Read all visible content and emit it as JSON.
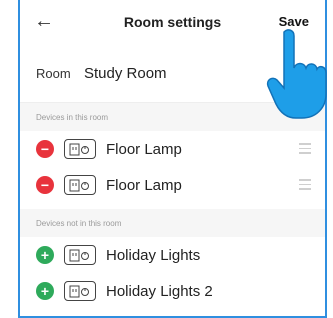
{
  "header": {
    "back_icon": "back-arrow-icon",
    "title": "Room settings",
    "save_label": "Save"
  },
  "room": {
    "label": "Room",
    "value": "Study Room"
  },
  "sections": {
    "in_room": "Devices in this room",
    "not_in_room": "Devices not in this room"
  },
  "devices_in_room": [
    {
      "name": "Floor Lamp"
    },
    {
      "name": "Floor Lamp"
    }
  ],
  "devices_not_in_room": [
    {
      "name": "Holiday Lights"
    },
    {
      "name": "Holiday Lights 2"
    }
  ],
  "colors": {
    "remove": "#e8333c",
    "add": "#2eaa5b",
    "frame": "#2f8fe0",
    "hand": "#1e9ee8"
  }
}
